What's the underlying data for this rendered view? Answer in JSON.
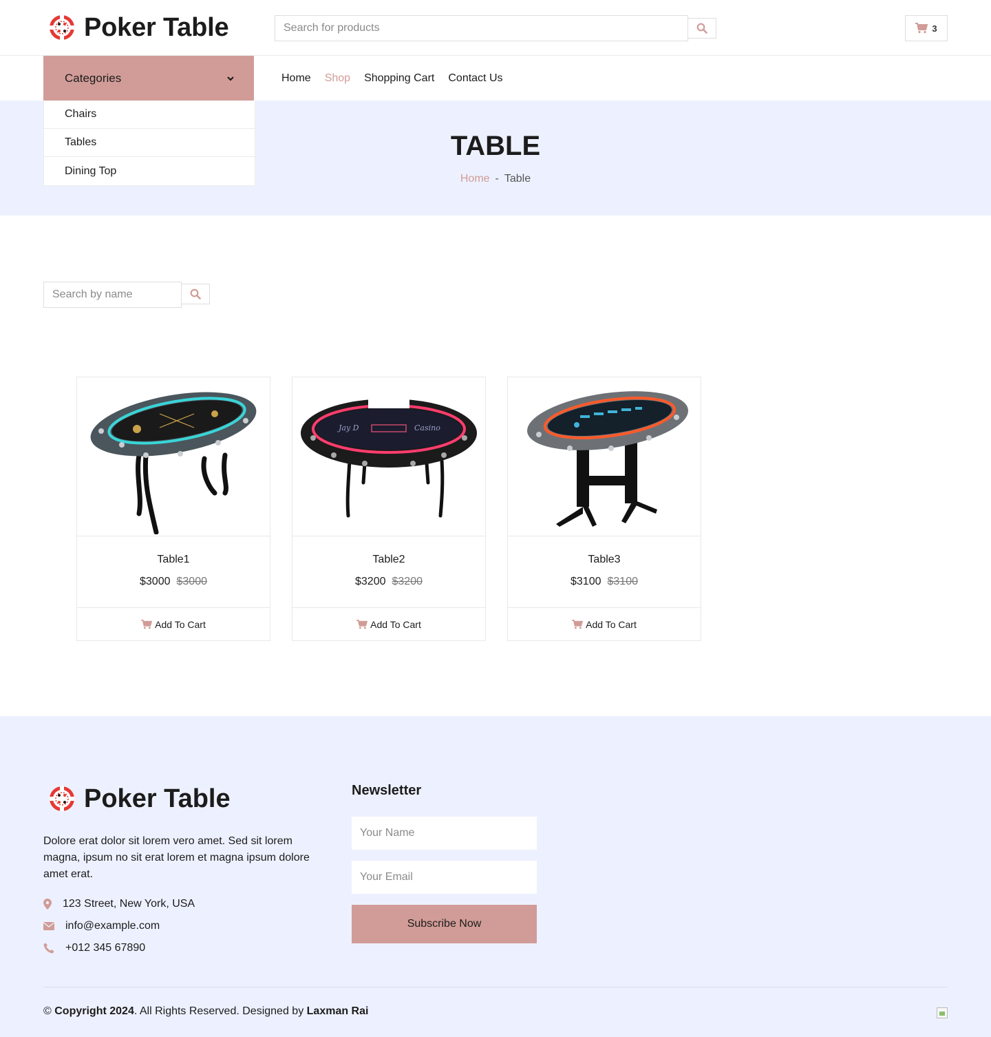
{
  "brand": {
    "name": "Poker Table"
  },
  "header": {
    "search_placeholder": "Search for products",
    "cart_count": "3"
  },
  "nav": {
    "categories_label": "Categories",
    "categories": [
      "Chairs",
      "Tables",
      "Dining Top"
    ],
    "links": [
      {
        "label": "Home",
        "active": false
      },
      {
        "label": "Shop",
        "active": true
      },
      {
        "label": "Shopping Cart",
        "active": false
      },
      {
        "label": "Contact Us",
        "active": false
      }
    ]
  },
  "banner": {
    "title": "TABLE",
    "breadcrumb": {
      "home": "Home",
      "sep": "-",
      "current": "Table"
    }
  },
  "shop": {
    "search_placeholder": "Search by name",
    "products": [
      {
        "name": "Table1",
        "price": "$3000",
        "old_price": "$3000",
        "action": "Add To Cart",
        "felt": "#1a1a1a",
        "glow": "#39d5d8"
      },
      {
        "name": "Table2",
        "price": "$3200",
        "old_price": "$3200",
        "action": "Add To Cart",
        "felt": "#1b1c2e",
        "glow": "#ff3d6e"
      },
      {
        "name": "Table3",
        "price": "$3100",
        "old_price": "$3100",
        "action": "Add To Cart",
        "felt": "#14202a",
        "glow": "#ff5a2a"
      }
    ]
  },
  "footer": {
    "description": "Dolore erat dolor sit lorem vero amet. Sed sit lorem magna, ipsum no sit erat lorem et magna ipsum dolore amet erat.",
    "address": "123 Street, New York, USA",
    "email": "info@example.com",
    "phone": "+012 345 67890",
    "newsletter": {
      "title": "Newsletter",
      "name_placeholder": "Your Name",
      "email_placeholder": "Your Email",
      "button": "Subscribe Now"
    },
    "copyright": {
      "symbol": "©",
      "strong": "Copyright 2024",
      "rest": ". All Rights Reserved. Designed by ",
      "designer": "Laxman Rai"
    }
  },
  "colors": {
    "accent": "#d19c97",
    "banner_bg": "#edf1ff",
    "logo_red": "#e53935"
  },
  "icons": {
    "search": "search-icon",
    "cart": "cart-icon",
    "chevron": "chevron-down-icon",
    "location": "map-marker-icon",
    "mail": "envelope-icon",
    "phone": "phone-icon"
  }
}
